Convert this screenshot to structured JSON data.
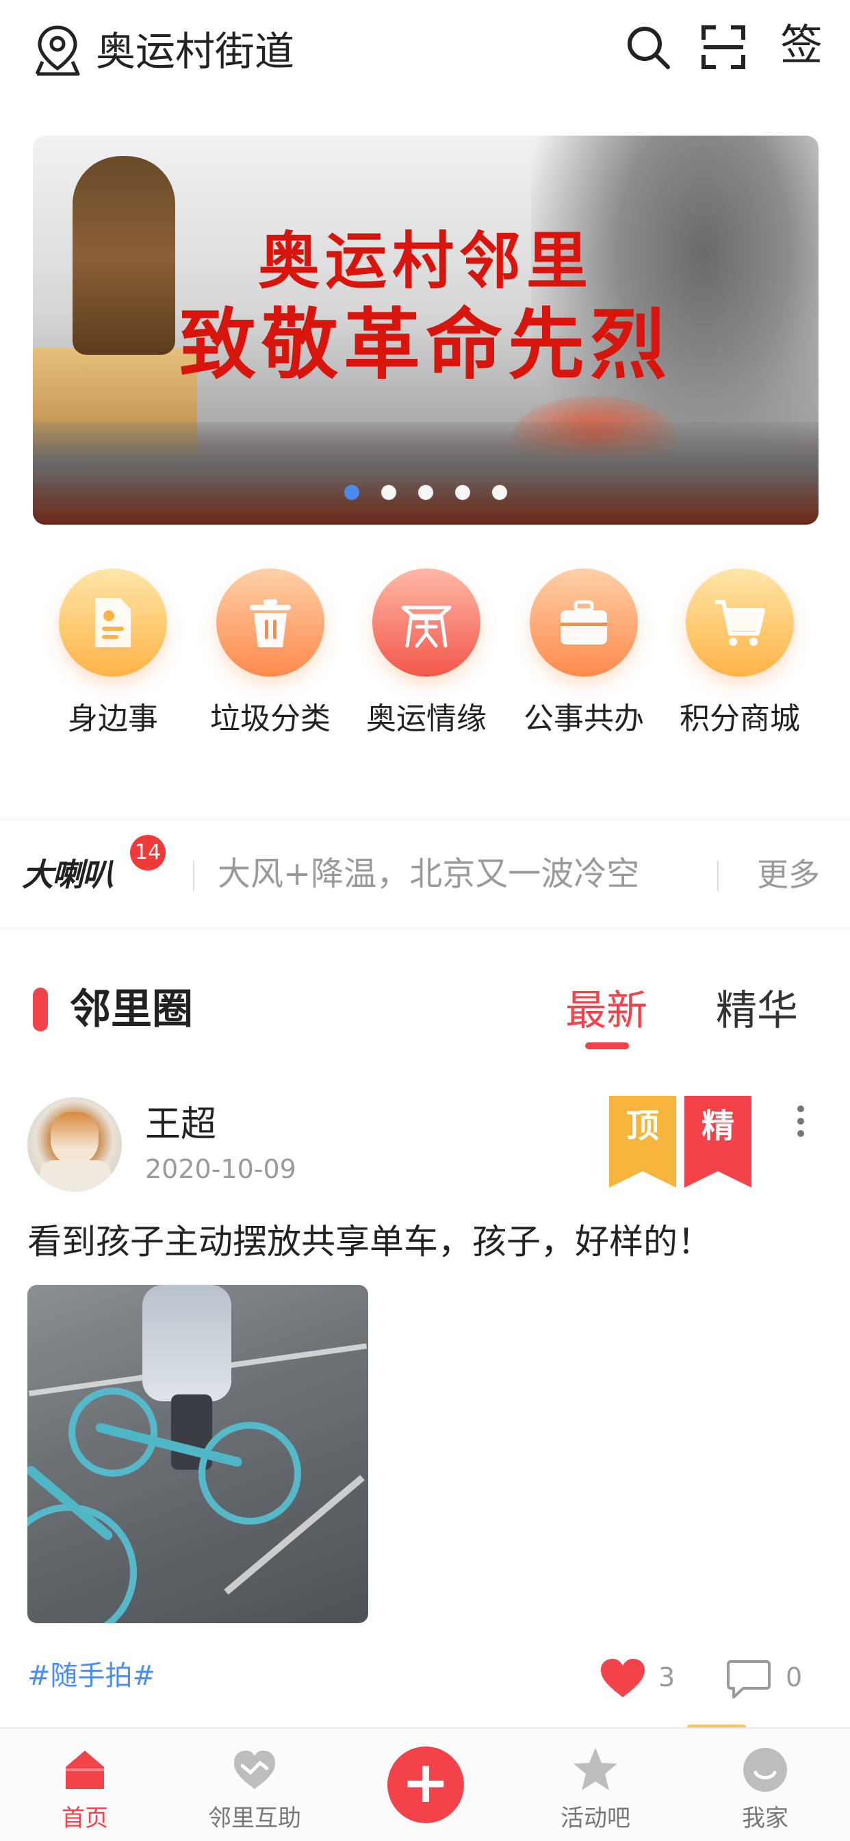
{
  "header": {
    "location": "奥运村街道",
    "sign_label": "签",
    "icons": [
      "location-pin-icon",
      "search-icon",
      "scan-icon"
    ]
  },
  "banner": {
    "title_line1": "奥运村邻里",
    "title_line2": "致敬革命先烈",
    "slide_count": 5,
    "active_slide": 1
  },
  "shortcuts": [
    {
      "label": "身边事",
      "icon": "document-icon",
      "color_from": "#ffe1a0",
      "color_to": "#ffb347"
    },
    {
      "label": "垃圾分类",
      "icon": "trash-icon",
      "color_from": "#ffc79a",
      "color_to": "#ff8a4c"
    },
    {
      "label": "奥运情缘",
      "icon": "olympic-tower-icon",
      "color_from": "#ffb0a0",
      "color_to": "#f2574a"
    },
    {
      "label": "公事共办",
      "icon": "briefcase-icon",
      "color_from": "#ffc79a",
      "color_to": "#ff8a4c"
    },
    {
      "label": "积分商城",
      "icon": "shopping-cart-icon",
      "color_from": "#ffe1a0",
      "color_to": "#ffb347"
    }
  ],
  "notice": {
    "logo": "大喇叭",
    "badge_count": "14",
    "text": "大风+降温，北京又一波冷空",
    "more_label": "更多"
  },
  "section": {
    "title": "邻里圈",
    "tabs": [
      {
        "label": "最新",
        "active": true
      },
      {
        "label": "精华",
        "active": false
      }
    ]
  },
  "post": {
    "username": "王超",
    "date": "2020-10-09",
    "badges": [
      {
        "label": "顶",
        "color": "#f5b43c"
      },
      {
        "label": "精",
        "color": "#f2424a"
      }
    ],
    "content": "看到孩子主动摆放共享单车，孩子，好样的！",
    "tag": "#随手拍#",
    "likes": "3",
    "comments": "0"
  },
  "nav": {
    "items": [
      {
        "label": "首页",
        "icon": "home-icon",
        "active": true
      },
      {
        "label": "邻里互助",
        "icon": "handshake-heart-icon",
        "active": false
      },
      {
        "label": "",
        "icon": "plus-icon",
        "active": false
      },
      {
        "label": "活动吧",
        "icon": "star-icon",
        "active": false
      },
      {
        "label": "我家",
        "icon": "smile-icon",
        "active": false
      }
    ],
    "add_symbol": "+"
  },
  "colors": {
    "accent": "#f2424a",
    "link": "#4a8ef5",
    "muted": "#9a9a9a"
  }
}
